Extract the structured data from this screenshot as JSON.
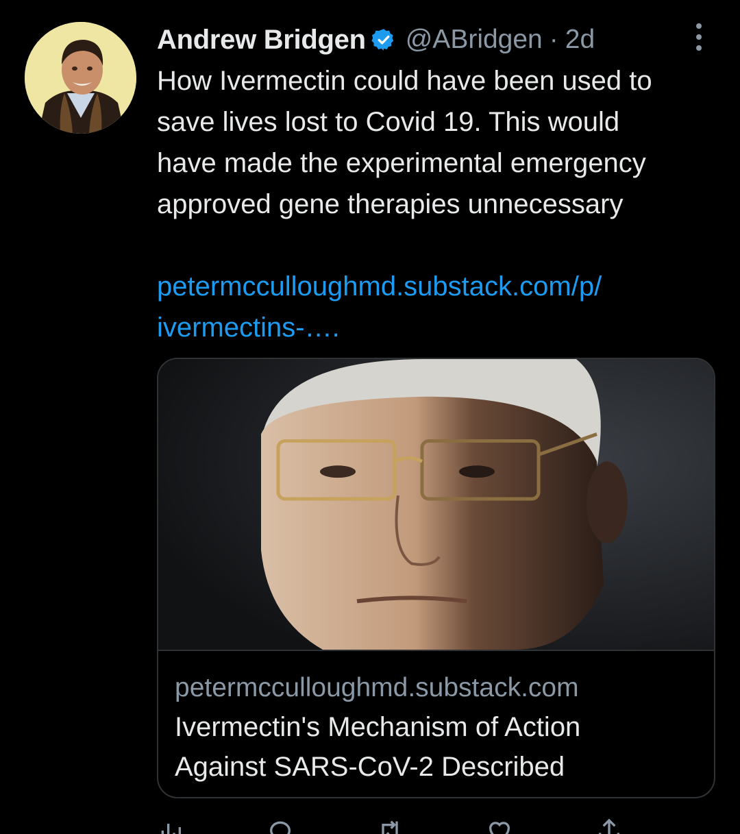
{
  "author": {
    "name": "Andrew Bridgen",
    "handle": "@ABridgen",
    "separator": "·",
    "time": "2d"
  },
  "tweet": {
    "line1": "How Ivermectin could have been used to",
    "line2": "save lives lost to Covid 19. This would",
    "line3": "have made the experimental emergency",
    "line4": "approved gene therapies unnecessary",
    "link_line1": "petermcculloughmd.substack.com/p/",
    "link_line2": "ivermectins-…."
  },
  "card": {
    "domain": "petermcculloughmd.substack.com",
    "title_line1": "Ivermectin's Mechanism of Action",
    "title_line2": "Against SARS-CoV-2 Described"
  },
  "colors": {
    "background": "#000000",
    "text": "#e7e9ea",
    "secondary": "#8b98a5",
    "link": "#1d9bf0",
    "border": "#2f3336"
  },
  "icons": {
    "verified": "verified-badge-icon",
    "more": "more-options-icon",
    "views": "views-icon",
    "reply": "reply-icon",
    "retweet": "retweet-icon",
    "like": "like-icon",
    "share": "share-icon"
  }
}
